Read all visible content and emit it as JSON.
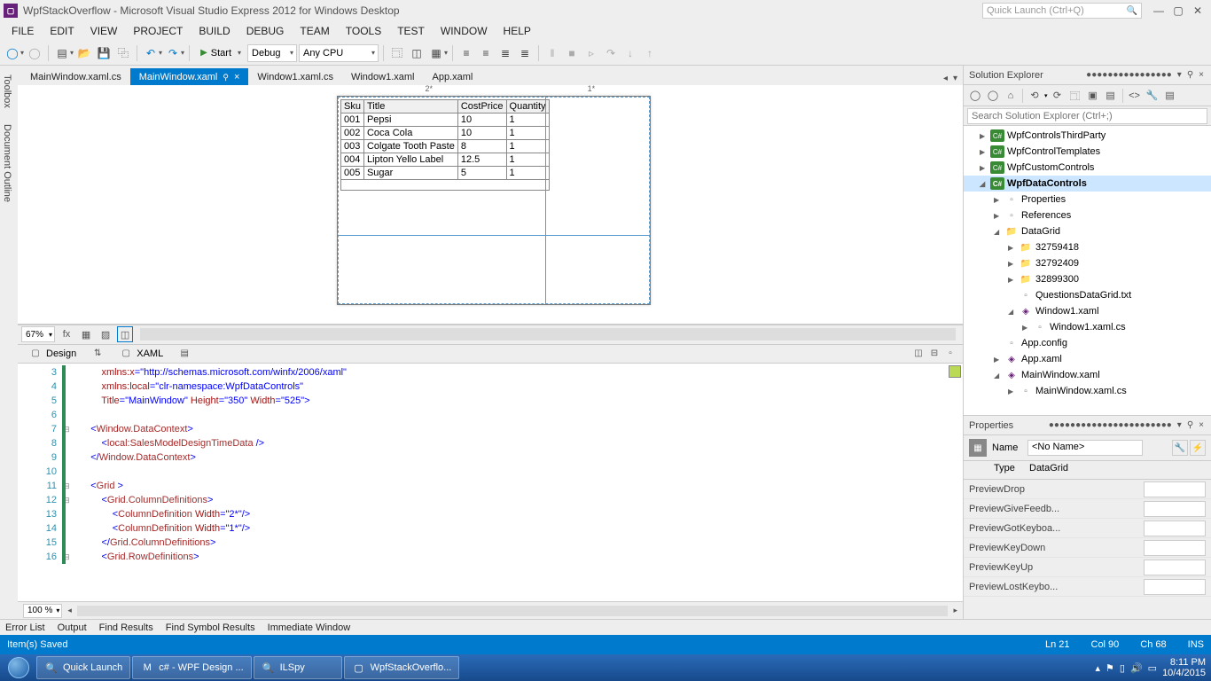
{
  "title": "WpfStackOverflow - Microsoft Visual Studio Express 2012 for Windows Desktop",
  "quick_launch_placeholder": "Quick Launch (Ctrl+Q)",
  "menu": [
    "FILE",
    "EDIT",
    "VIEW",
    "PROJECT",
    "BUILD",
    "DEBUG",
    "TEAM",
    "TOOLS",
    "TEST",
    "WINDOW",
    "HELP"
  ],
  "toolbar": {
    "start": "Start",
    "config": "Debug",
    "platform": "Any CPU"
  },
  "tabs": [
    {
      "label": "MainWindow.xaml.cs",
      "active": false
    },
    {
      "label": "MainWindow.xaml",
      "active": true
    },
    {
      "label": "Window1.xaml.cs",
      "active": false
    },
    {
      "label": "Window1.xaml",
      "active": false
    },
    {
      "label": "App.xaml",
      "active": false
    }
  ],
  "designer": {
    "zoom": "67%",
    "star1": "2*",
    "star2": "1*",
    "table_headers": [
      "Sku",
      "Title",
      "CostPrice",
      "Quantity"
    ],
    "table_rows": [
      [
        "001",
        "Pepsi",
        "10",
        "1"
      ],
      [
        "002",
        "Coca Cola",
        "10",
        "1"
      ],
      [
        "003",
        "Colgate Tooth Paste",
        "8",
        "1"
      ],
      [
        "004",
        "Lipton Yello Label",
        "12.5",
        "1"
      ],
      [
        "005",
        "Sugar",
        "5",
        "1"
      ]
    ]
  },
  "split": {
    "design": "Design",
    "xaml": "XAML"
  },
  "code": {
    "zoom": "100 %",
    "lines": {
      "l3_attr": "xmlns:x",
      "l3_eq": "=",
      "l3_val": "\"http://schemas.microsoft.com/winfx/2006/xaml\"",
      "l4_attr": "xmlns:local",
      "l4_eq": "=",
      "l4_val": "\"clr-namespace:WpfDataControls\"",
      "l5_a1": "Title",
      "l5_v1": "\"MainWindow\"",
      "l5_a2": " Height",
      "l5_v2": "\"350\"",
      "l5_a3": " Width",
      "l5_v3": "\"525\"",
      "l5_end": ">",
      "l7_o": "<",
      "l7_t": "Window.DataContext",
      "l7_c": ">",
      "l8_o": "<",
      "l8_t": "local:SalesModelDesignTimeData",
      "l8_se": " />",
      "l9_o": "</",
      "l9_t": "Window.DataContext",
      "l9_c": ">",
      "l11_o": "<",
      "l11_t": "Grid ",
      "l11_c": ">",
      "l12_o": "<",
      "l12_t": "Grid.ColumnDefinitions",
      "l12_c": ">",
      "l13_o": "<",
      "l13_t": "ColumnDefinition",
      "l13_a": " Width",
      "l13_v": "\"2*\"",
      "l13_se": "/>",
      "l14_o": "<",
      "l14_t": "ColumnDefinition",
      "l14_a": " Width",
      "l14_v": "\"1*\"",
      "l14_se": "/>",
      "l15_o": "</",
      "l15_t": "Grid.ColumnDefinitions",
      "l15_c": ">",
      "l16_o": "<",
      "l16_t": "Grid.RowDefinitions",
      "l16_c": ">"
    },
    "nums": [
      "3",
      "4",
      "5",
      "6",
      "7",
      "8",
      "9",
      "10",
      "11",
      "12",
      "13",
      "14",
      "15",
      "16"
    ]
  },
  "outer_tabs": [
    "Error List",
    "Output",
    "Find Results",
    "Find Symbol Results",
    "Immediate Window"
  ],
  "status": {
    "left": "Item(s) Saved",
    "ln": "Ln 21",
    "col": "Col 90",
    "ch": "Ch 68",
    "ins": "INS"
  },
  "solution": {
    "title": "Solution Explorer",
    "search_placeholder": "Search Solution Explorer (Ctrl+;)",
    "nodes": [
      {
        "ind": 1,
        "arrow": "▶",
        "icon": "cs",
        "label": "WpfControlsThirdParty"
      },
      {
        "ind": 1,
        "arrow": "▶",
        "icon": "cs",
        "label": "WpfControlTemplates"
      },
      {
        "ind": 1,
        "arrow": "▶",
        "icon": "cs",
        "label": "WpfCustomControls"
      },
      {
        "ind": 1,
        "arrow": "◢",
        "icon": "cs",
        "label": "WpfDataControls",
        "sel": true
      },
      {
        "ind": 2,
        "arrow": "▶",
        "icon": "file",
        "label": "Properties"
      },
      {
        "ind": 2,
        "arrow": "▶",
        "icon": "file",
        "label": "References"
      },
      {
        "ind": 2,
        "arrow": "◢",
        "icon": "fld",
        "label": "DataGrid"
      },
      {
        "ind": 3,
        "arrow": "▶",
        "icon": "fld",
        "label": "32759418"
      },
      {
        "ind": 3,
        "arrow": "▶",
        "icon": "fld",
        "label": "32792409"
      },
      {
        "ind": 3,
        "arrow": "▶",
        "icon": "fld",
        "label": "32899300"
      },
      {
        "ind": 3,
        "arrow": "",
        "icon": "file",
        "label": "QuestionsDataGrid.txt"
      },
      {
        "ind": 3,
        "arrow": "◢",
        "icon": "xaml",
        "label": "Window1.xaml"
      },
      {
        "ind": 4,
        "arrow": "▶",
        "icon": "file",
        "label": "Window1.xaml.cs"
      },
      {
        "ind": 2,
        "arrow": "",
        "icon": "file",
        "label": "App.config"
      },
      {
        "ind": 2,
        "arrow": "▶",
        "icon": "xaml",
        "label": "App.xaml"
      },
      {
        "ind": 2,
        "arrow": "◢",
        "icon": "xaml",
        "label": "MainWindow.xaml"
      },
      {
        "ind": 3,
        "arrow": "▶",
        "icon": "file",
        "label": "MainWindow.xaml.cs"
      }
    ]
  },
  "properties": {
    "title": "Properties",
    "name_lbl": "Name",
    "name_val": "<No Name>",
    "type_lbl": "Type",
    "type_val": "DataGrid",
    "rows": [
      "PreviewDrop",
      "PreviewGiveFeedb...",
      "PreviewGotKeyboa...",
      "PreviewKeyDown",
      "PreviewKeyUp",
      "PreviewLostKeybo..."
    ]
  },
  "taskbar": {
    "items": [
      {
        "label": "Quick Launch",
        "icon": "🔍",
        "cls": "ql"
      },
      {
        "label": "c# - WPF Design ...",
        "icon": "M"
      },
      {
        "label": "ILSpy",
        "icon": "🔍"
      },
      {
        "label": "WpfStackOverflo...",
        "icon": "▢"
      }
    ],
    "time": "8:11 PM",
    "date": "10/4/2015"
  },
  "left_rails": [
    "Toolbox",
    "Document Outline"
  ]
}
